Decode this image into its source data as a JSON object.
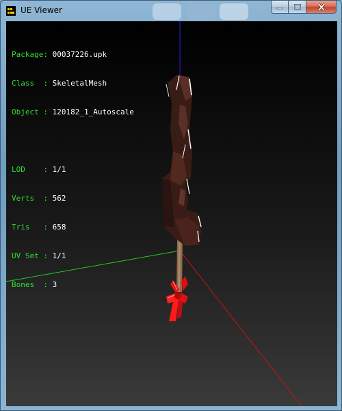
{
  "window": {
    "title": "UE Viewer",
    "colors": {
      "frame": "#7ba7c7",
      "close": "#c7462c"
    }
  },
  "titlebar_icons": [
    "app-icon",
    "minimize-icon",
    "maximize-icon",
    "close-icon"
  ],
  "info": {
    "package_label": "Package: ",
    "package_value": "00037226.upk",
    "class_label": "Class  : ",
    "class_value": "SkeletalMesh",
    "object_label": "Object : ",
    "object_value": "120182_1_Autoscale",
    "lod_label": "LOD    : ",
    "lod_value": "1/1",
    "verts_label": "Verts  : ",
    "verts_value": "562",
    "tris_label": "Tris   : ",
    "tris_value": "658",
    "uvset_label": "UV Set : ",
    "uvset_value": "1/1",
    "bones_label": "Bones  : ",
    "bones_value": "3"
  },
  "scene": {
    "axis_colors": {
      "x": "#cc1111",
      "y": "#22cc22",
      "z": "#2222dd"
    },
    "mesh_color": "#3a1c16",
    "ribbon_color": "#ee1111"
  }
}
